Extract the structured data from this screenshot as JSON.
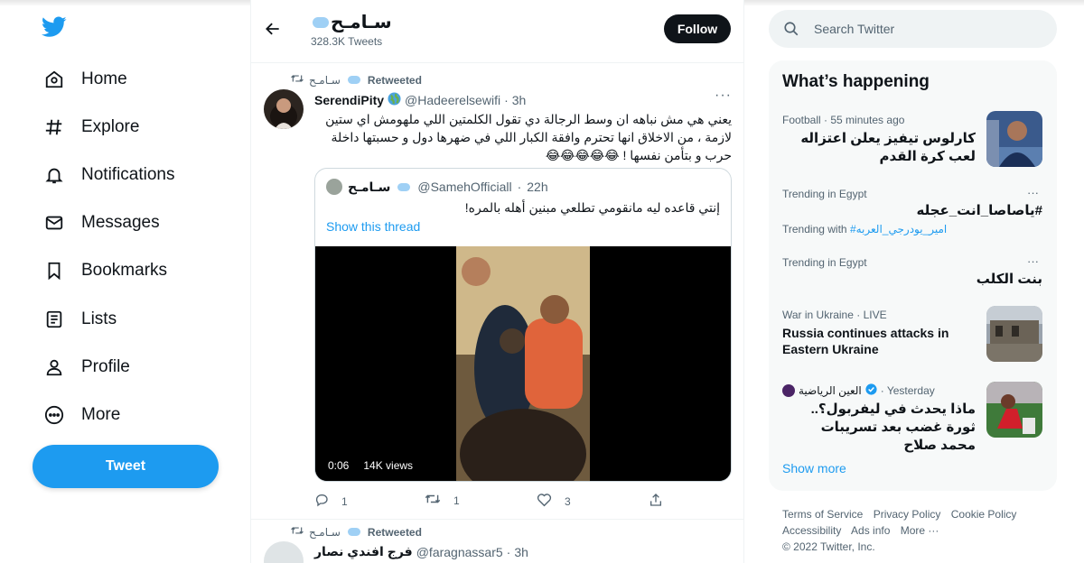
{
  "nav": {
    "items": [
      {
        "label": "Home",
        "icon": "home-icon"
      },
      {
        "label": "Explore",
        "icon": "hashtag-icon"
      },
      {
        "label": "Notifications",
        "icon": "bell-icon"
      },
      {
        "label": "Messages",
        "icon": "envelope-icon"
      },
      {
        "label": "Bookmarks",
        "icon": "bookmark-icon"
      },
      {
        "label": "Lists",
        "icon": "list-icon"
      },
      {
        "label": "Profile",
        "icon": "person-icon"
      },
      {
        "label": "More",
        "icon": "more-circle-icon"
      }
    ],
    "tweet_label": "Tweet"
  },
  "header": {
    "name": "سـامـح",
    "tweet_count": "328.3K Tweets",
    "follow_label": "Follow"
  },
  "tweet1": {
    "retweeter": "سـامـح",
    "retweeted_label": "Retweeted",
    "author_name": "SerendiPity",
    "handle": "@Hadeerelsewifi",
    "time": "3h",
    "text": "يعني هي مش نباهه ان وسط الرجالة دي تقول الكلمتين اللي ملهومش اي ستين لازمة ، من الاخلاق انها تحترم وافقة الكبار اللي في ضهرها دول و حسبتها داخلة حرب و بتأمن نفسها ! 😂😂😂😂😂",
    "quote": {
      "author_name": "سـامـح",
      "handle": "@SamehOfficiall",
      "time": "22h",
      "text": "إنتي قاعده ليه مانقومي تطلعي مبنين أهله بالمره!",
      "show_thread": "Show this thread",
      "video_time": "0:06",
      "video_views": "14K views"
    },
    "replies": "1",
    "retweets": "1",
    "likes": "3"
  },
  "tweet2": {
    "retweeter": "سـامـح",
    "retweeted_label": "Retweeted",
    "author_name": "فرج افندي نصار",
    "handle": "@faragnassar5",
    "time": "3h"
  },
  "search": {
    "placeholder": "Search Twitter"
  },
  "happening": {
    "title": "What’s happening",
    "trends": [
      {
        "meta": "Football · 55 minutes ago",
        "title": "كارلوس تيفيز يعلن اعتزاله لعب كرة القدم"
      },
      {
        "meta": "Trending in Egypt",
        "title": "#ياصاصا_انت_عجله",
        "sub_prefix": "Trending with",
        "sub_tag": "#امير_يودرجي_العربه"
      },
      {
        "meta": "Trending in Egypt",
        "title": "بنت الكلب"
      },
      {
        "meta": "War in Ukraine · LIVE",
        "title": "Russia continues attacks in Eastern Ukraine"
      },
      {
        "meta_name": "العين الرياضية",
        "meta_time": "· Yesterday",
        "title": "ماذا يحدث في ليفربول؟.. ثورة غضب بعد تسريبات محمد صلاح"
      }
    ],
    "show_more": "Show more"
  },
  "footer": {
    "links": [
      "Terms of Service",
      "Privacy Policy",
      "Cookie Policy",
      "Accessibility",
      "Ads info",
      "More ···"
    ],
    "copyright": "© 2022 Twitter, Inc."
  },
  "colors": {
    "accent": "#1d9bf0",
    "text": "#0f1419",
    "muted": "#536471"
  }
}
